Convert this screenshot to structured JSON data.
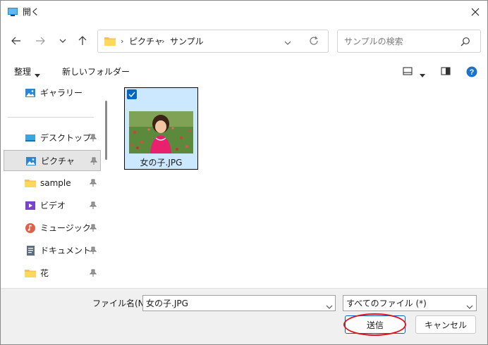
{
  "window": {
    "title": "開く"
  },
  "nav": {
    "address_parts": [
      "ピクチャ",
      "サンプル"
    ],
    "search_placeholder": "サンプルの検索"
  },
  "toolbar": {
    "organize_label": "整理",
    "new_folder_label": "新しいフォルダー"
  },
  "sidebar": {
    "items": [
      {
        "label": "ギャラリー",
        "icon": "gallery-icon"
      },
      {
        "label": "デスクトップ",
        "icon": "desktop-icon",
        "pinned": true
      },
      {
        "label": "ピクチャ",
        "icon": "pictures-icon",
        "pinned": true,
        "selected": true
      },
      {
        "label": "sample",
        "icon": "folder-icon",
        "pinned": true
      },
      {
        "label": "ビデオ",
        "icon": "video-icon",
        "pinned": true
      },
      {
        "label": "ミュージック",
        "icon": "music-icon",
        "pinned": true
      },
      {
        "label": "ドキュメント",
        "icon": "document-icon",
        "pinned": true
      },
      {
        "label": "花",
        "icon": "folder-icon",
        "pinned": true
      }
    ]
  },
  "files": [
    {
      "name": "女の子.JPG",
      "selected": true,
      "checked": true
    }
  ],
  "bottom": {
    "filename_label": "ファイル名(N):",
    "filename_value": "女の子.JPG",
    "filetype_value": "すべてのファイル (*)",
    "open_button": "送信",
    "cancel_button": "キャンセル"
  },
  "colors": {
    "accent": "#0067c0",
    "selection": "#cce8ff",
    "annotation": "#e0141e",
    "folder": "#f6c343"
  }
}
